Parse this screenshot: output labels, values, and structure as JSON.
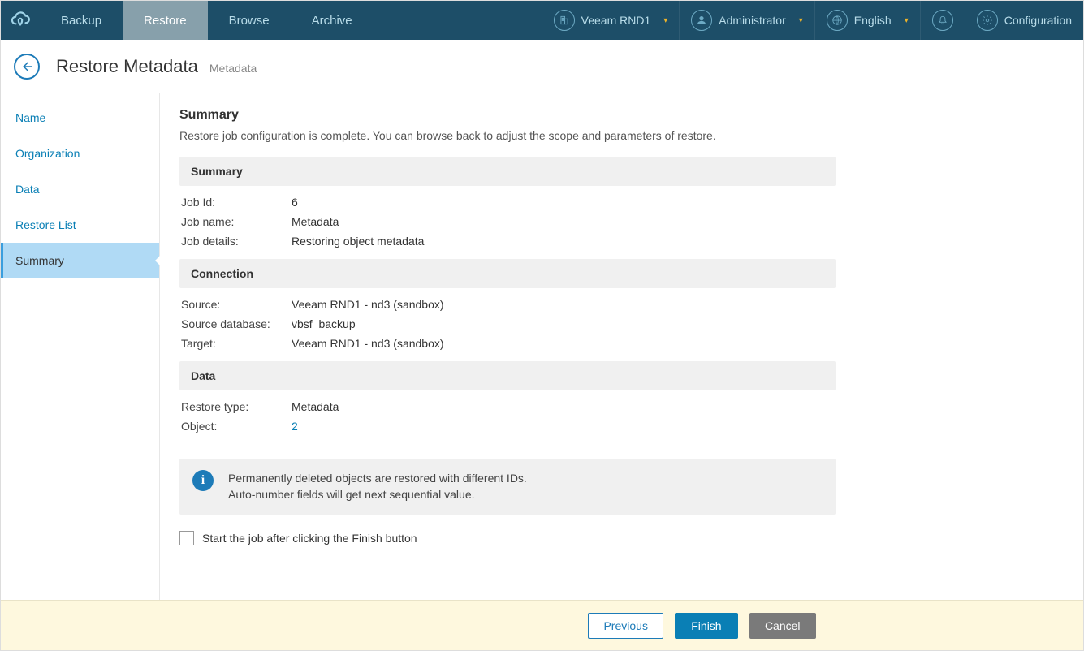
{
  "topnav": {
    "tabs": [
      "Backup",
      "Restore",
      "Browse",
      "Archive"
    ],
    "active_index": 1,
    "org": "Veeam RND1",
    "user": "Administrator",
    "language": "English",
    "config_label": "Configuration"
  },
  "title": {
    "main": "Restore Metadata",
    "sub": "Metadata"
  },
  "sidebar": {
    "steps": [
      "Name",
      "Organization",
      "Data",
      "Restore List",
      "Summary"
    ],
    "current_index": 4
  },
  "content": {
    "heading": "Summary",
    "description": "Restore job configuration is complete. You can browse back to adjust the scope and parameters of restore.",
    "sections": {
      "summary": {
        "title": "Summary",
        "rows": [
          {
            "k": "Job Id:",
            "v": "6"
          },
          {
            "k": "Job name:",
            "v": "Metadata"
          },
          {
            "k": "Job details:",
            "v": "Restoring object metadata"
          }
        ]
      },
      "connection": {
        "title": "Connection",
        "rows": [
          {
            "k": "Source:",
            "v": "Veeam RND1 - nd3 (sandbox)"
          },
          {
            "k": "Source database:",
            "v": "vbsf_backup"
          },
          {
            "k": "Target:",
            "v": "Veeam RND1 - nd3 (sandbox)"
          }
        ]
      },
      "data": {
        "title": "Data",
        "rows": [
          {
            "k": "Restore type:",
            "v": "Metadata"
          },
          {
            "k": "Object:",
            "v": "2",
            "link": true
          }
        ]
      }
    },
    "info": {
      "line1": "Permanently deleted objects are restored with different IDs.",
      "line2": "Auto-number fields will get next sequential value."
    },
    "checkbox_label": "Start the job after clicking the Finish button"
  },
  "footer": {
    "previous": "Previous",
    "finish": "Finish",
    "cancel": "Cancel"
  }
}
